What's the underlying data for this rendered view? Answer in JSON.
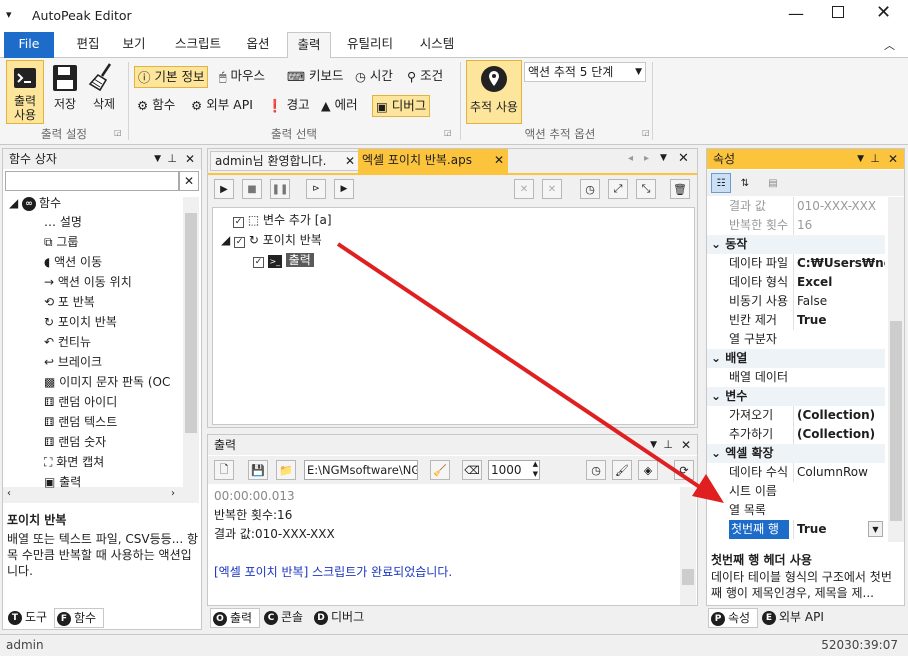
{
  "window": {
    "title": "AutoPeak Editor",
    "menu_icon": "menu-chevron-icon"
  },
  "menu": {
    "file": "File",
    "tabs": [
      "편집",
      "보기",
      "스크립트",
      "옵션",
      "출력",
      "유틸리티",
      "시스템"
    ],
    "active": "출력"
  },
  "ribbon": {
    "output_settings": {
      "print_use": "출력\n사용",
      "save": "저장",
      "delete": "삭제",
      "title": "출력 설정"
    },
    "output_select": {
      "items": [
        "기본 정보",
        "마우스",
        "키보드",
        "시간",
        "조건",
        "함수",
        "외부 API",
        "경고",
        "에러",
        "디버그"
      ],
      "title": "출력 선택"
    },
    "trace": {
      "use": "추적 사용",
      "dropdown": "액션 추적 5 단계",
      "title": "액션 추적 옵션"
    }
  },
  "func_panel": {
    "title": "함수 상자",
    "search_value": "",
    "root": "함수",
    "items": [
      "설명",
      "그룹",
      "액션 이동",
      "액션 이동 위치",
      "포 반복",
      "포이치 반복",
      "컨티뉴",
      "브레이크",
      "이미지 문자 판독 (OC",
      "랜덤 아이디",
      "랜덤 텍스트",
      "랜덤 숫자",
      "화면 캡쳐",
      "출력"
    ],
    "desc_title": "포이치 반복",
    "desc_text": "배열 또는 텍스트 파일, CSV등등... 항목 수만큼 반복할 때 사용하는 액션입니다.",
    "bottom_tabs": [
      "도구",
      "함수"
    ]
  },
  "editor": {
    "tabs": [
      "admin님 환영합니다.",
      "엑셀 포이치 반복.aps"
    ],
    "tree": {
      "var_add": "변수 추가 [a]",
      "foreach": "포이치 반복",
      "output": "출력"
    }
  },
  "output_panel": {
    "title": "출력",
    "path": "E:\\NGMsoftware\\NG",
    "number": "1000",
    "lines": [
      "00:00:00.013",
      "반복한 횟수:16",
      "결과 값:010-XXX-XXX",
      "",
      "[엑셀 포이치 반복] 스크립트가 완료되었습니다."
    ],
    "bottom_tabs": [
      "출력",
      "콘솔",
      "디버그"
    ]
  },
  "props": {
    "title": "속성",
    "rows": [
      {
        "k": "결과 값",
        "v": "010-XXX-XXX",
        "type": "dim"
      },
      {
        "k": "반복한 횟수",
        "v": "16",
        "type": "dim"
      },
      {
        "k": "동작",
        "v": "",
        "type": "cat"
      },
      {
        "k": "데이타 파일",
        "v": "C:₩Users₩ngma",
        "type": "bold"
      },
      {
        "k": "데이타 형식",
        "v": "Excel",
        "type": "bold"
      },
      {
        "k": "비동기 사용",
        "v": "False",
        "type": "normal"
      },
      {
        "k": "빈칸 제거",
        "v": "True",
        "type": "bold"
      },
      {
        "k": "열 구분자",
        "v": "",
        "type": "normal"
      },
      {
        "k": "배열",
        "v": "",
        "type": "cat"
      },
      {
        "k": "배열 데이터",
        "v": "",
        "type": "normal"
      },
      {
        "k": "변수",
        "v": "",
        "type": "cat"
      },
      {
        "k": "가져오기",
        "v": "(Collection)",
        "type": "bold"
      },
      {
        "k": "추가하기",
        "v": "(Collection)",
        "type": "bold"
      },
      {
        "k": "엑셀 확장",
        "v": "",
        "type": "cat"
      },
      {
        "k": "데이타 수식",
        "v": "ColumnRow",
        "type": "normal"
      },
      {
        "k": "시트 이름",
        "v": "",
        "type": "normal"
      },
      {
        "k": "열 목록",
        "v": "",
        "type": "normal"
      },
      {
        "k": "첫번째 행",
        "v": "True",
        "type": "selected"
      }
    ],
    "desc_title": "첫번째 행 헤더 사용",
    "desc_text": "데이타 테이블 형식의 구조에서 첫번째 행이 제목인경우, 제목을 제...",
    "bottom_tabs": [
      "속성",
      "외부 API"
    ]
  },
  "status": {
    "user": "admin",
    "time": "52030:39:07"
  },
  "colors": {
    "accent": "#1e6cc9",
    "highlight": "#fde69b",
    "panel_title": "#fcc33d",
    "arrow": "#e02020",
    "selection": "#1e6cc9"
  }
}
